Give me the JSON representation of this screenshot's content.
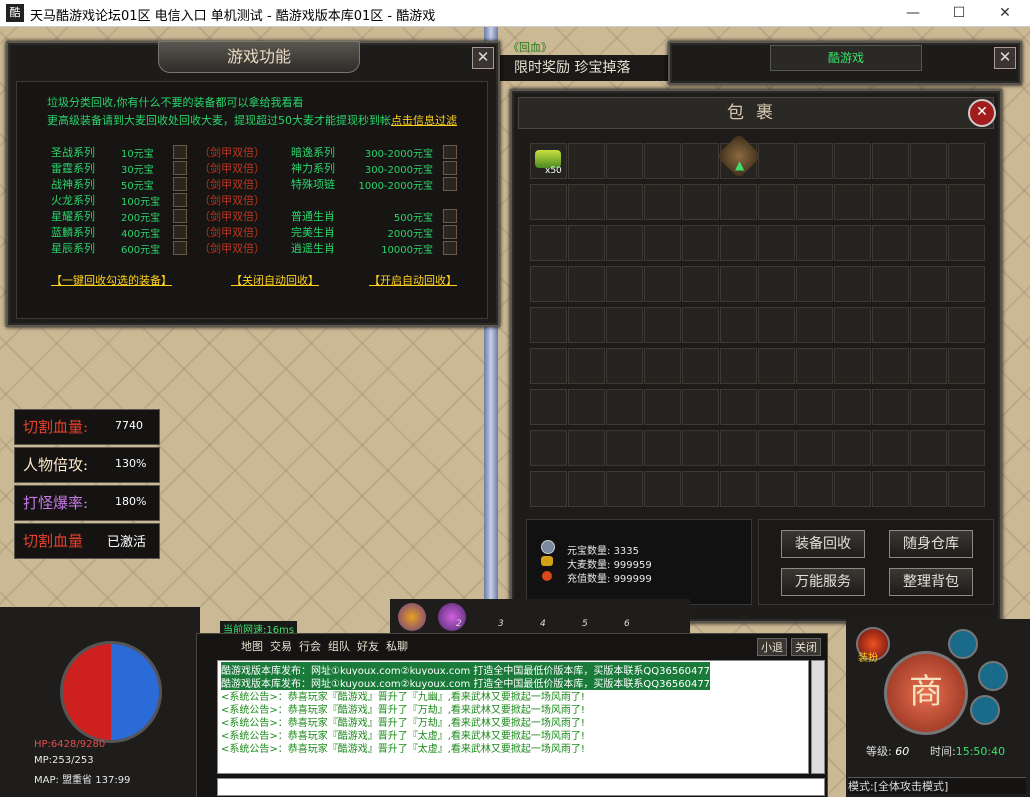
{
  "window": {
    "title": "天马酷游戏论坛01区 电信入口 单机测试 - 酷游戏版本库01区 - 酷游戏",
    "icon": "酷",
    "minimize": "—",
    "maximize": "☐",
    "close": "✕"
  },
  "func_panel": {
    "title": "游戏功能",
    "close": "✕",
    "intro1": "垃圾分类回收,你有什么不要的装备都可以拿给我看看",
    "intro2_prefix": "更高级装备请到大麦回收处回收大麦，提现超过50大麦才能提现秒到帐",
    "intro2_link": "点击信息过滤",
    "left_rows": [
      {
        "name": "圣战系列",
        "price": "10元宝",
        "bonus": "（剑甲双倍）"
      },
      {
        "name": "雷霆系列",
        "price": "30元宝",
        "bonus": "（剑甲双倍）"
      },
      {
        "name": "战神系列",
        "price": "50元宝",
        "bonus": "（剑甲双倍）"
      },
      {
        "name": "火龙系列",
        "price": "100元宝",
        "bonus": "（剑甲双倍）"
      },
      {
        "name": "星耀系列",
        "price": "200元宝",
        "bonus": "（剑甲双倍）"
      },
      {
        "name": "蓝麟系列",
        "price": "400元宝",
        "bonus": "（剑甲双倍）"
      },
      {
        "name": "星辰系列",
        "price": "600元宝",
        "bonus": "（剑甲双倍）"
      }
    ],
    "right_rows": [
      {
        "name": "暗逸系列",
        "price": "300-2000元宝"
      },
      {
        "name": "神力系列",
        "price": "300-2000元宝"
      },
      {
        "name": "特殊项链",
        "price": "1000-2000元宝"
      },
      {
        "name": "",
        "price": ""
      },
      {
        "name": "普通生肖",
        "price": "500元宝"
      },
      {
        "name": "完美生肖",
        "price": "2000元宝"
      },
      {
        "name": "逍遥生肖",
        "price": "10000元宝"
      }
    ],
    "btn_recycle_selected": "【一键回收勾选的装备】",
    "btn_close_auto": "【关闭自动回收】",
    "btn_open_auto": "【开启自动回收】"
  },
  "banner": {
    "reward": "限时奖励  珍宝掉落",
    "back_to_city": "《回血》"
  },
  "stats": [
    {
      "label": "切割血量:",
      "value": "7740",
      "color": "#e8402a"
    },
    {
      "label": "人物倍攻:",
      "value": "130%",
      "color": "#ffe8c8"
    },
    {
      "label": "打怪爆率:",
      "value": "180%",
      "color": "#c878e8"
    },
    {
      "label": "切割血量",
      "value": "已激活",
      "color": "#e8402a"
    }
  ],
  "right_panel": {
    "title": "酷游戏",
    "close": "✕"
  },
  "bag": {
    "title": "包裹",
    "close": "✕",
    "rows": 9,
    "cols": 12,
    "item_count": "x50",
    "yuanbao_label": "元宝数量:",
    "yuanbao_value": "3335",
    "damai_label": "大麦数量:",
    "damai_value": "999959",
    "recharge_label": "充值数量:",
    "recharge_value": "999999",
    "btn_recycle": "装备回收",
    "btn_storage": "随身仓库",
    "btn_service": "万能服务",
    "btn_sort": "整理背包"
  },
  "net_speed": "当前网速:16ms",
  "skill_slots": [
    "2",
    "3",
    "4",
    "5",
    "6"
  ],
  "chat": {
    "tabs": [
      "地图",
      "交易",
      "行会",
      "组队",
      "好友",
      "私聊"
    ],
    "btn_exit": "小退",
    "btn_close": "关闭",
    "lines": [
      {
        "type": "ad",
        "text": "酷游戏版本库发布：网址①kuyoux.com②kuyoux.com 打造全中国最低价版本库，买版本联系QQ36560477"
      },
      {
        "type": "ad",
        "text": "酷游戏版本库发布：网址①kuyoux.com②kuyoux.com 打造全中国最低价版本库，买版本联系QQ36560477"
      },
      {
        "type": "sys",
        "text": "<系统公告>：恭喜玩家『酷游戏』晋升了『九幽』,看来武林又要掀起一场风雨了!"
      },
      {
        "type": "sys",
        "text": "<系统公告>：恭喜玩家『酷游戏』晋升了『万劫』,看来武林又要掀起一场风雨了!"
      },
      {
        "type": "sys",
        "text": "<系统公告>：恭喜玩家『酷游戏』晋升了『万劫』,看来武林又要掀起一场风雨了!"
      },
      {
        "type": "sys",
        "text": "<系统公告>：恭喜玩家『酷游戏』晋升了『太虚』,看来武林又要掀起一场风雨了!"
      },
      {
        "type": "sys",
        "text": "<系统公告>：恭喜玩家『酷游戏』晋升了『太虚』,看来武林又要掀起一场风雨了!"
      }
    ]
  },
  "player": {
    "hp_label": "HP:",
    "hp_value": "6428/9280",
    "mp_label": "MP:",
    "mp_value": "253/253",
    "map_label": "MAP:",
    "map_value": "盟重省 137:99"
  },
  "hud": {
    "shop": "商",
    "gift": "装扮",
    "level_label": "等级:",
    "level_value": "60",
    "time_label": "时间:",
    "time_value": "15:50:40",
    "mode": "模式:[全体攻击模式]"
  }
}
